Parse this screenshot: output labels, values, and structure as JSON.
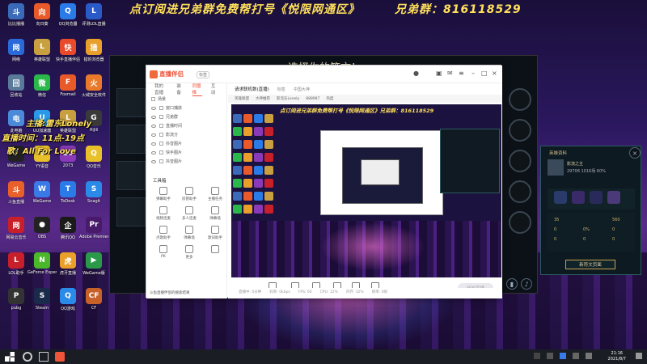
{
  "banner": {
    "left": "点订阅进兄弟群免费帮打号《悦限网通区》",
    "right": "兄弟群：816118529"
  },
  "desktop_icons": [
    {
      "label": "比比播播",
      "color": "#3a6ab8",
      "glyph": "斗"
    },
    {
      "label": "向日葵",
      "color": "#e85a2a",
      "glyph": "向"
    },
    {
      "label": "QQ浏览器",
      "color": "#2a7ae8",
      "glyph": "Q"
    },
    {
      "label": "评测LOL直播",
      "color": "#2a5ac8",
      "glyph": "L"
    },
    {
      "label": "网络",
      "color": "#2a6ad8",
      "glyph": "网"
    },
    {
      "label": "英雄联盟",
      "color": "#c8a040",
      "glyph": "L"
    },
    {
      "label": "快手直播伴侣",
      "color": "#e84a2a",
      "glyph": "快"
    },
    {
      "label": "猎豹浏览器",
      "color": "#e8a02a",
      "glyph": "猎"
    },
    {
      "label": "回收站",
      "color": "#5a7a9a",
      "glyph": "回"
    },
    {
      "label": "微信",
      "color": "#2ab84a",
      "glyph": "微"
    },
    {
      "label": "Foxmail",
      "color": "#e85a2a",
      "glyph": "F"
    },
    {
      "label": "火绒安全软件",
      "color": "#e87a2a",
      "glyph": "火"
    },
    {
      "label": "此电脑",
      "color": "#4a8ad8",
      "glyph": "电"
    },
    {
      "label": "UU加速器",
      "color": "#2a9ae8",
      "glyph": "U"
    },
    {
      "label": "英雄联盟",
      "color": "#c8a040",
      "glyph": "L"
    },
    {
      "label": "HiJili",
      "color": "#3a3a3a",
      "glyph": "G"
    },
    {
      "label": "WeGame",
      "color": "#222",
      "glyph": "♪"
    },
    {
      "label": "YY语音",
      "color": "#e8c02a",
      "glyph": "Y"
    },
    {
      "label": "2073",
      "color": "#8a3ab8",
      "glyph": "20"
    },
    {
      "label": "QQ音乐",
      "color": "#e8c02a",
      "glyph": "Q"
    },
    {
      "label": "斗鱼直播",
      "color": "#e8602a",
      "glyph": "斗"
    },
    {
      "label": "WeGame",
      "color": "#3a7ae8",
      "glyph": "W"
    },
    {
      "label": "ToDesk",
      "color": "#2a7ae8",
      "glyph": "T"
    },
    {
      "label": "Snagit",
      "color": "#2a8ae8",
      "glyph": "S"
    },
    {
      "label": "网易云音乐",
      "color": "#c8202a",
      "glyph": "网"
    },
    {
      "label": "OBS",
      "color": "#222",
      "glyph": "●"
    },
    {
      "label": "腾讯QQ",
      "color": "#1a1a1a",
      "glyph": "企"
    },
    {
      "label": "Adobe Premiere",
      "color": "#4a1a6a",
      "glyph": "Pr"
    },
    {
      "label": "LOL助手",
      "color": "#c8202a",
      "glyph": "L"
    },
    {
      "label": "GeForce Experience",
      "color": "#4ab82a",
      "glyph": "N"
    },
    {
      "label": "虎牙直播",
      "color": "#e8a02a",
      "glyph": "虎"
    },
    {
      "label": "WeGame版",
      "color": "#2a9a4a",
      "glyph": "▶"
    },
    {
      "label": "pubg",
      "color": "#333",
      "glyph": "P"
    },
    {
      "label": "Steam",
      "color": "#1a2a4a",
      "glyph": "S"
    },
    {
      "label": "QQ游戏",
      "color": "#2a8ae8",
      "glyph": "Q"
    },
    {
      "label": "CF",
      "color": "#c8602a",
      "glyph": "CF"
    }
  ],
  "overlay": {
    "name": "主播:雷东Lonely",
    "time": "直播时间：11点-19点",
    "song": "歌：All For Love"
  },
  "game": {
    "title": "选择你的符文！",
    "side_panel_title": "英雄资料",
    "hero_name": "影流之主",
    "hero_stats": "29708 1016场 60%",
    "stats": [
      "35",
      "0",
      "0",
      "560",
      "0",
      "0",
      "0",
      "0%"
    ],
    "rune_button": "新符文页面"
  },
  "app": {
    "logo": "直播伴侣",
    "version": "标签",
    "sidebar_tabs": [
      "我的直播",
      "装备",
      "同盟推",
      "互动"
    ],
    "active_sidebar_tab": 2,
    "scene_header": "场景",
    "scenes": [
      "窗口捕获",
      "兄弟群",
      "直播时间",
      "影流分",
      "抖音图片",
      "快手图片",
      "抖音图片"
    ],
    "tools_title": "工具箱",
    "tools": [
      "弹幕助手",
      "房管助手",
      "主播任务",
      "视频连麦",
      "多人连麦",
      "弹幕墙",
      "点歌助手",
      "弹幕墙",
      "歌词助手",
      "PK",
      "更多",
      ""
    ],
    "hint": "斗鱼直播伴侣的搜索结果",
    "main_head": [
      "请求联机数(直播)",
      "标签",
      "中国大神"
    ],
    "sub_head": [
      "英雄联盟",
      "大神推荐",
      "影流东Lonely",
      "888987",
      "热度"
    ],
    "preview_text": "点订阅进兄弟群免费帮打号《悦限网通区》兄弟群：816118529",
    "bottom_tools": [
      "直播间管理",
      "摄像头",
      "录制直播",
      "多媒体",
      "麦克风",
      "扬声器"
    ],
    "start_button": "开始直播",
    "status": [
      "直播中: 0分钟",
      "码率: 0kbps",
      "FPS: 60",
      "CPU: 12%",
      "内存: 32%",
      "帧率: 0帧"
    ]
  },
  "taskbar": {
    "time": "21:16",
    "date": "2021/8/7"
  }
}
